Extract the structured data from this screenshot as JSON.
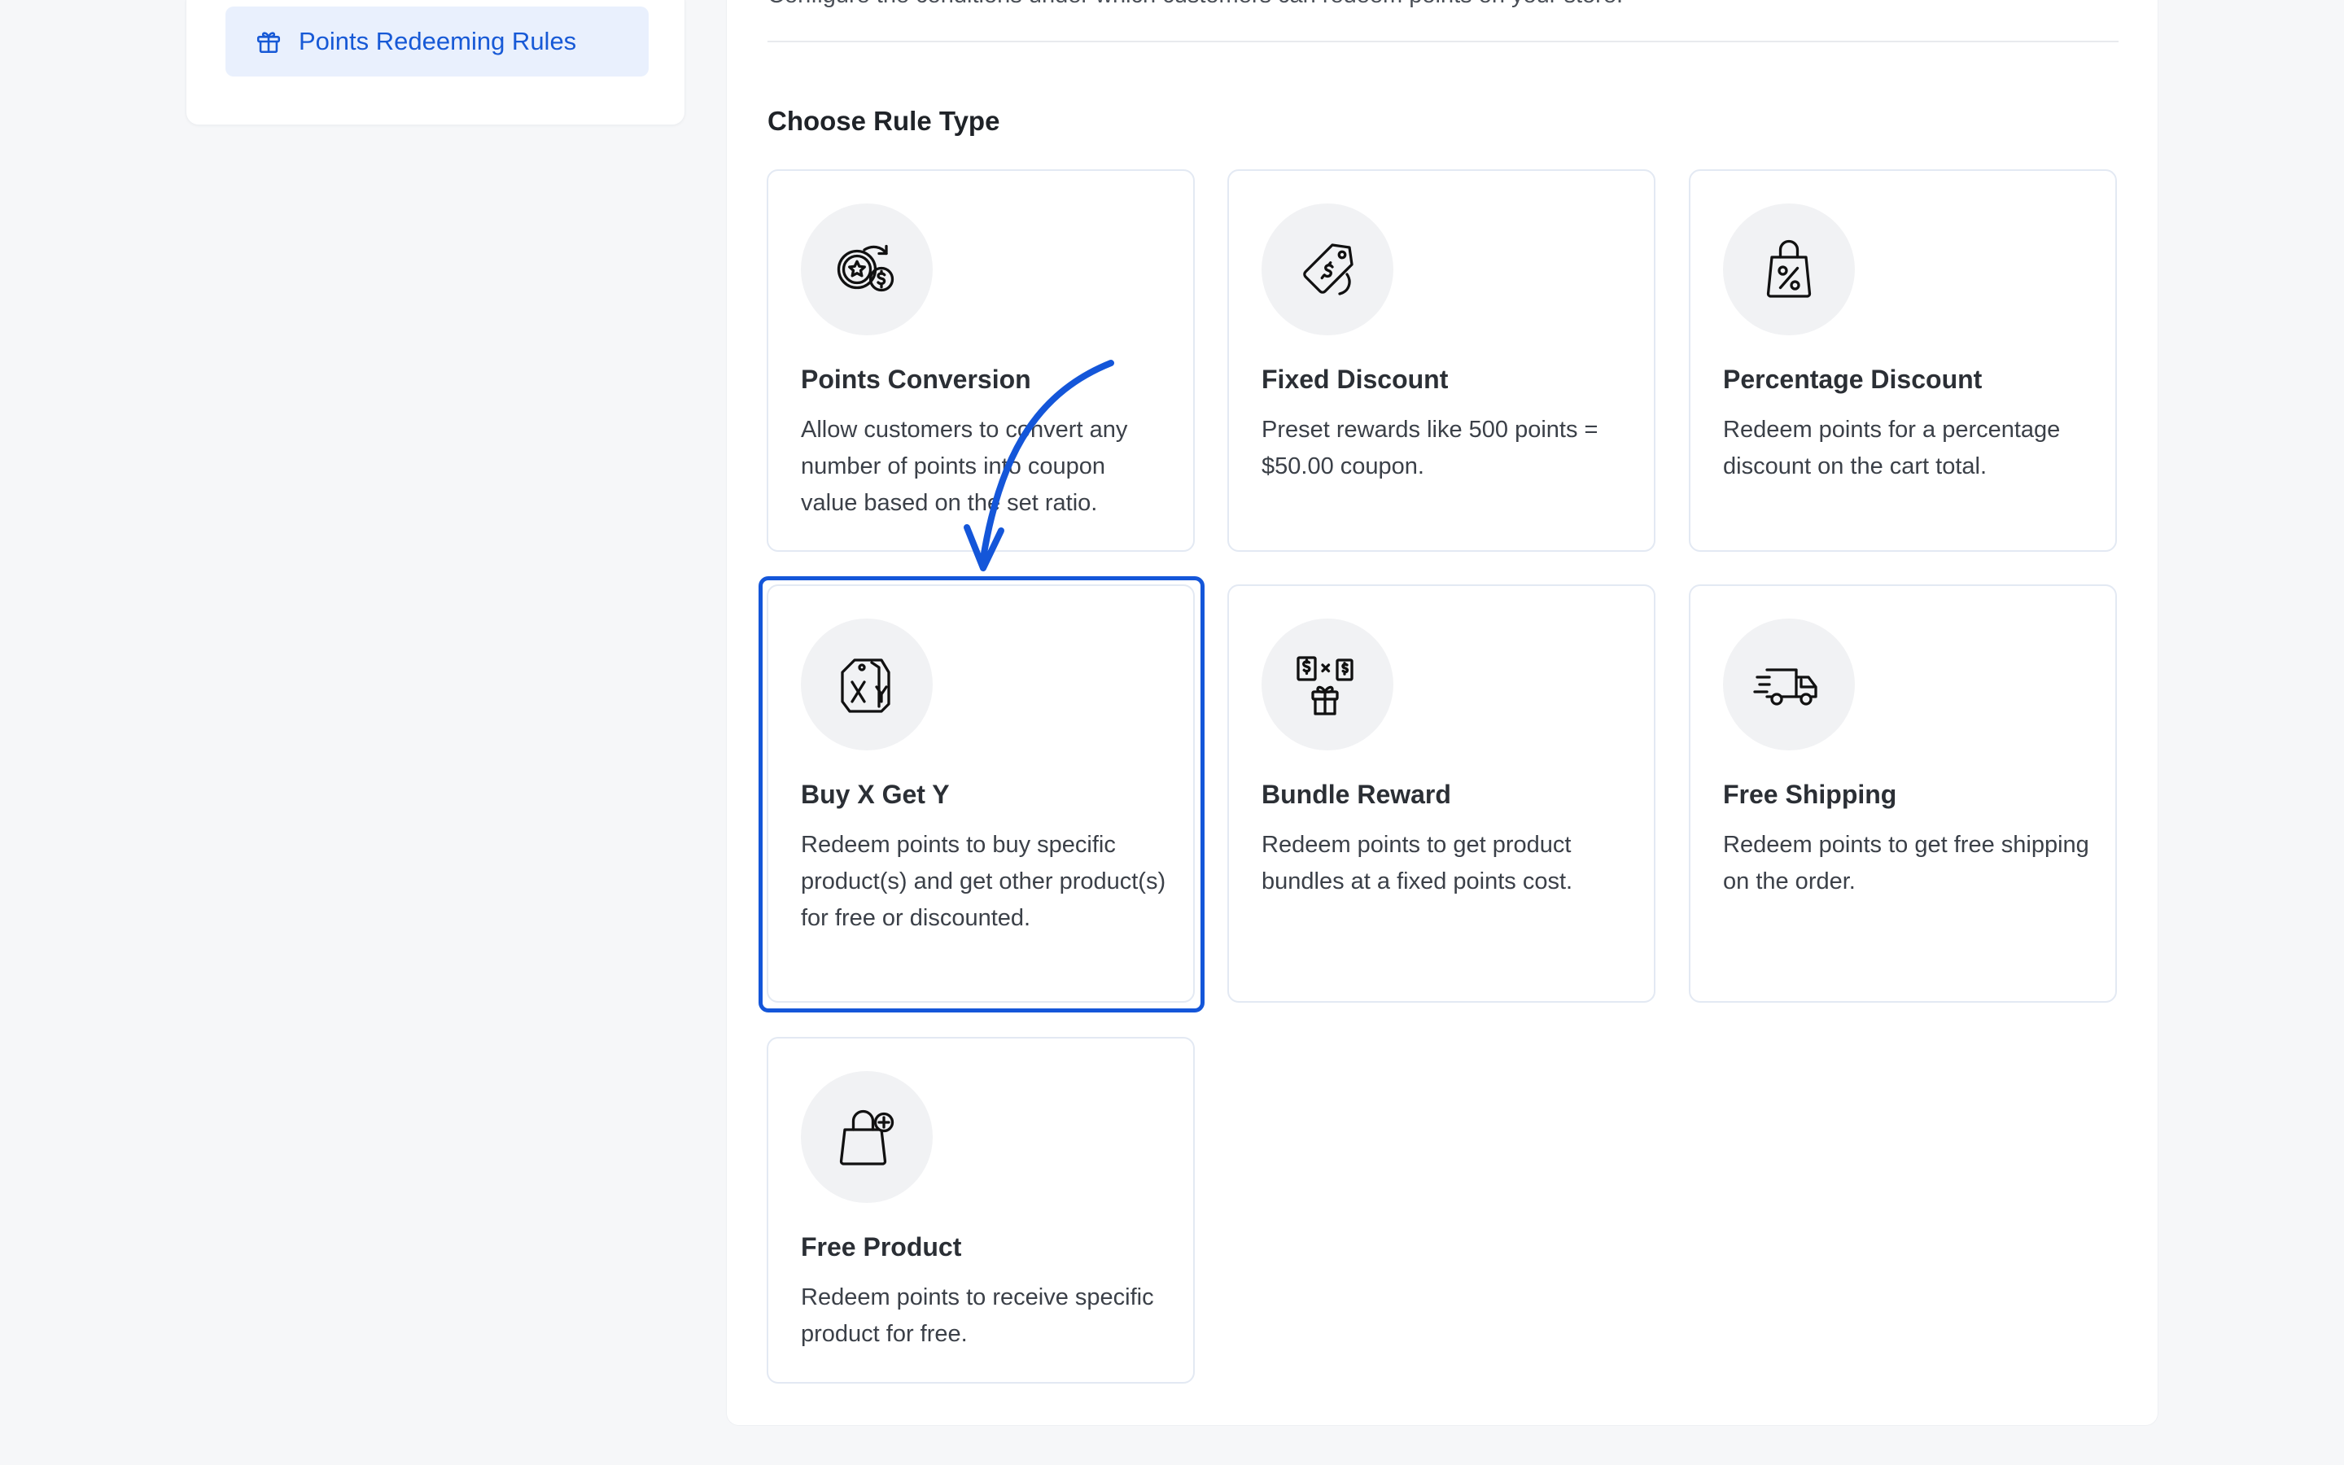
{
  "sidebar": {
    "active_item": {
      "label": "Points Redeeming Rules",
      "icon": "gift-icon"
    }
  },
  "main": {
    "description": "Configure the conditions under which customers can redeem points on your store.",
    "section_title": "Choose Rule Type",
    "cards": [
      {
        "title": "Points Conversion",
        "desc": "Allow customers to convert any number of points into coupon value based on the set ratio.",
        "icon": "points-conversion-icon"
      },
      {
        "title": "Fixed Discount",
        "desc": "Preset rewards like 500 points = $50.00 coupon.",
        "icon": "price-tag-icon"
      },
      {
        "title": "Percentage Discount",
        "desc": "Redeem points for a percentage discount on the cart total.",
        "icon": "percent-bag-icon"
      },
      {
        "title": "Buy X Get Y",
        "desc": "Redeem points to buy specific product(s) and get other product(s) for free or discounted.",
        "icon": "buy-x-get-y-icon"
      },
      {
        "title": "Bundle Reward",
        "desc": "Redeem points to get product bundles at a fixed points cost.",
        "icon": "bundle-reward-icon"
      },
      {
        "title": "Free Shipping",
        "desc": "Redeem points to get free shipping on the order.",
        "icon": "delivery-truck-icon"
      },
      {
        "title": "Free Product",
        "desc": "Redeem points to receive specific product for free.",
        "icon": "bag-plus-icon"
      }
    ]
  },
  "colors": {
    "accent": "#1456d9",
    "nav_active_bg": "#e9f0fd",
    "nav_active_text": "#1759d6",
    "card_border": "#e3e9f3",
    "icon_bg": "#f1f2f4",
    "page_bg": "#f6f7f9"
  }
}
